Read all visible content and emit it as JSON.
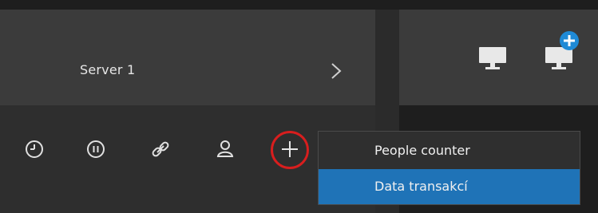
{
  "server": {
    "label": "Server 1"
  },
  "toolbar": {
    "icons": [
      "clock-icon",
      "pause-icon",
      "link-icon",
      "user-icon",
      "plus-icon"
    ]
  },
  "menu": {
    "items": [
      {
        "label": "People counter",
        "selected": false
      },
      {
        "label": "Data transakcí",
        "selected": true
      }
    ]
  },
  "colors": {
    "accent_selected": "#1f73b7",
    "highlight_circle": "#d81e1e",
    "add_badge": "#1f8ad6"
  }
}
